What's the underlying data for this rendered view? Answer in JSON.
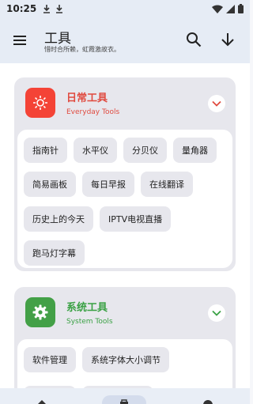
{
  "status_bar": {
    "time": "10:25",
    "icons": [
      "download-icon",
      "download-icon",
      "wifi-icon",
      "cellular-icon",
      "battery-icon"
    ]
  },
  "app_bar": {
    "title": "工具",
    "subtitle": "惜时合所赖，虹霞激故衣。",
    "icons": [
      "menu-icon",
      "search-icon",
      "download-arrow-icon"
    ]
  },
  "cards": [
    {
      "title": "日常工具",
      "subtitle": "Everyday Tools",
      "accent": "#e04a3f",
      "icon_bg": "#f44336",
      "icon": "sun-icon",
      "expanded": true,
      "items": [
        "指南针",
        "水平仪",
        "分贝仪",
        "量角器",
        "简易画板",
        "每日早报",
        "在线翻译",
        "历史上的今天",
        "IPTV电视直播",
        "跑马灯字幕"
      ]
    },
    {
      "title": "系统工具",
      "subtitle": "System Tools",
      "accent": "#3aa144",
      "icon_bg": "#43a047",
      "icon": "gear-icon",
      "expanded": false,
      "items": [
        "软件管理",
        "系统字体大小调节"
      ]
    }
  ],
  "bottom_nav": {
    "icons": [
      "home-icon",
      "tools-icon",
      "profile-icon"
    ],
    "selected": 1
  }
}
